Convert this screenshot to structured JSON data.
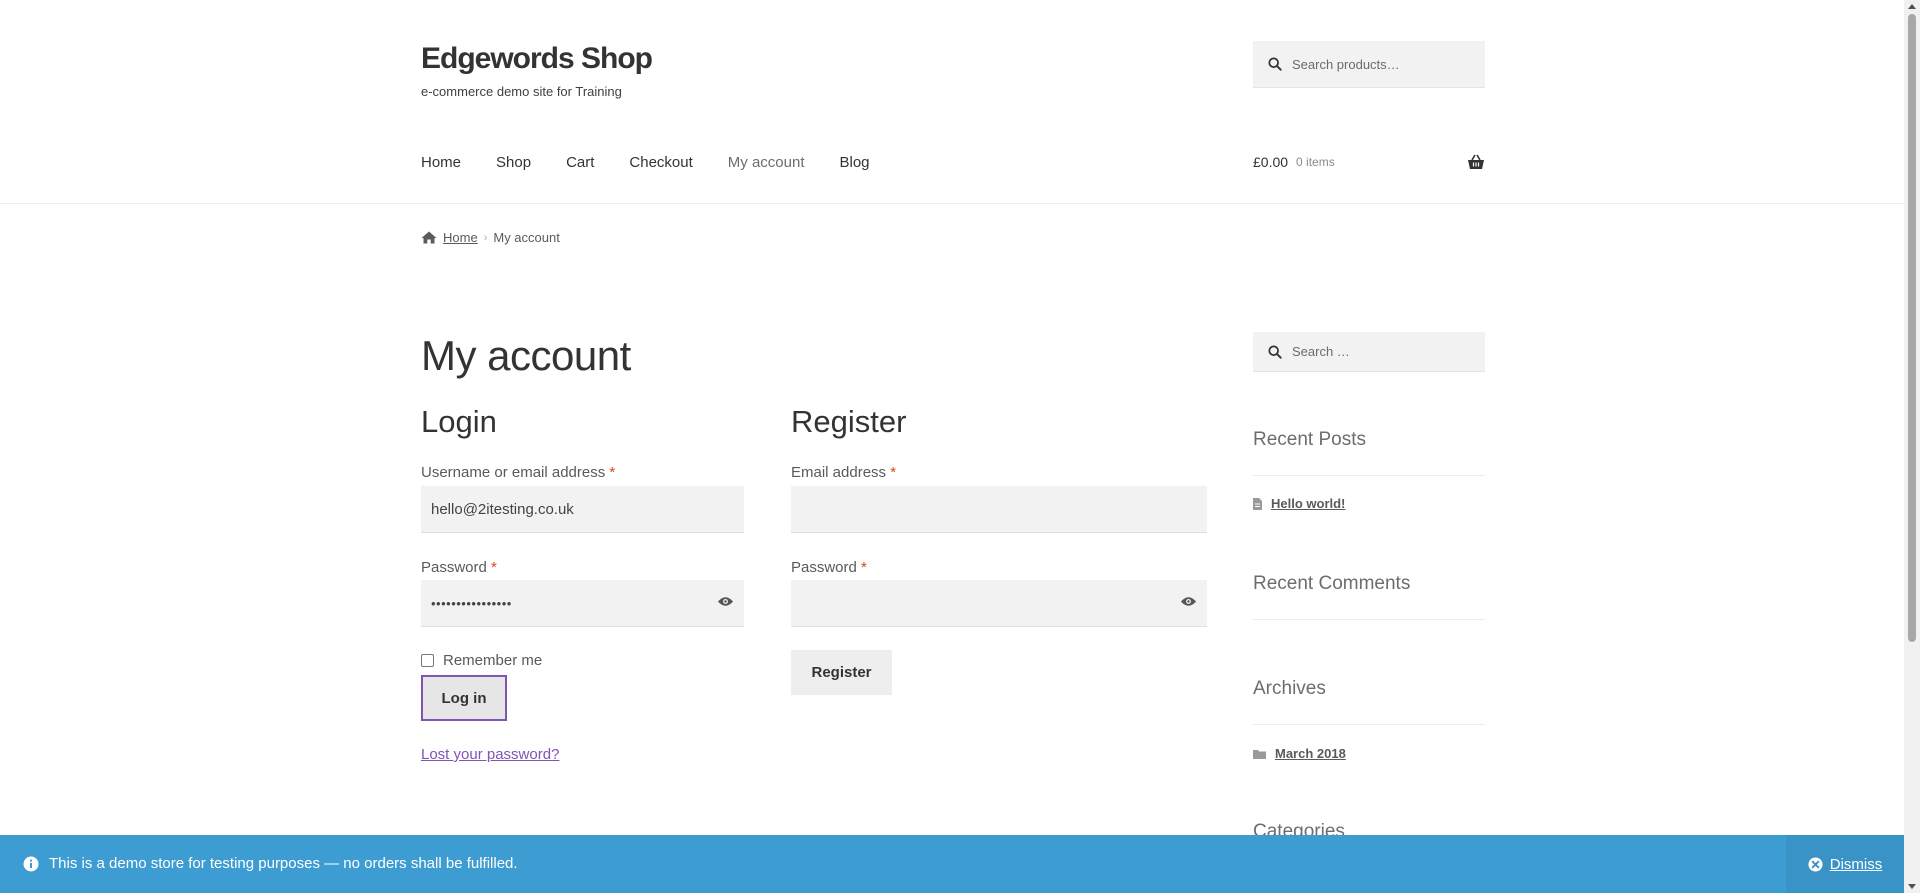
{
  "site": {
    "title": "Edgewords Shop",
    "tagline": "e-commerce demo site for Training"
  },
  "header_search": {
    "placeholder": "Search products…",
    "icon": "search-icon"
  },
  "nav": {
    "items": [
      "Home",
      "Shop",
      "Cart",
      "Checkout",
      "My account",
      "Blog"
    ],
    "active": "My account"
  },
  "cart": {
    "amount": "£0.00",
    "count": "0 items",
    "icon": "basket-icon"
  },
  "breadcrumb": {
    "home": "Home",
    "separator": "›",
    "current": "My account",
    "icon": "home-icon"
  },
  "page": {
    "title": "My account"
  },
  "login": {
    "title": "Login",
    "username_label": "Username or email address",
    "username_value": "hello@2itesting.co.uk",
    "password_label": "Password",
    "password_value": "••••••••••••••••",
    "required_marker": "*",
    "remember_label": "Remember me",
    "remember_checked": false,
    "button": "Log in",
    "lost_password": "Lost your password?"
  },
  "register": {
    "title": "Register",
    "email_label": "Email address",
    "password_label": "Password",
    "required_marker": "*",
    "button": "Register"
  },
  "sidebar": {
    "search_placeholder": "Search …",
    "recent_posts_title": "Recent Posts",
    "recent_posts": [
      "Hello world!"
    ],
    "recent_comments_title": "Recent Comments",
    "archives_title": "Archives",
    "archives": [
      "March 2018"
    ],
    "categories_title": "Categories"
  },
  "notice": {
    "message": "This is a demo store for testing purposes — no orders shall be fulfilled.",
    "dismiss": "Dismiss"
  },
  "colors": {
    "accent": "#7f54b3",
    "required": "#e2401c",
    "notice_bg": "#3d9cd2",
    "field_bg": "#f2f2f2"
  }
}
